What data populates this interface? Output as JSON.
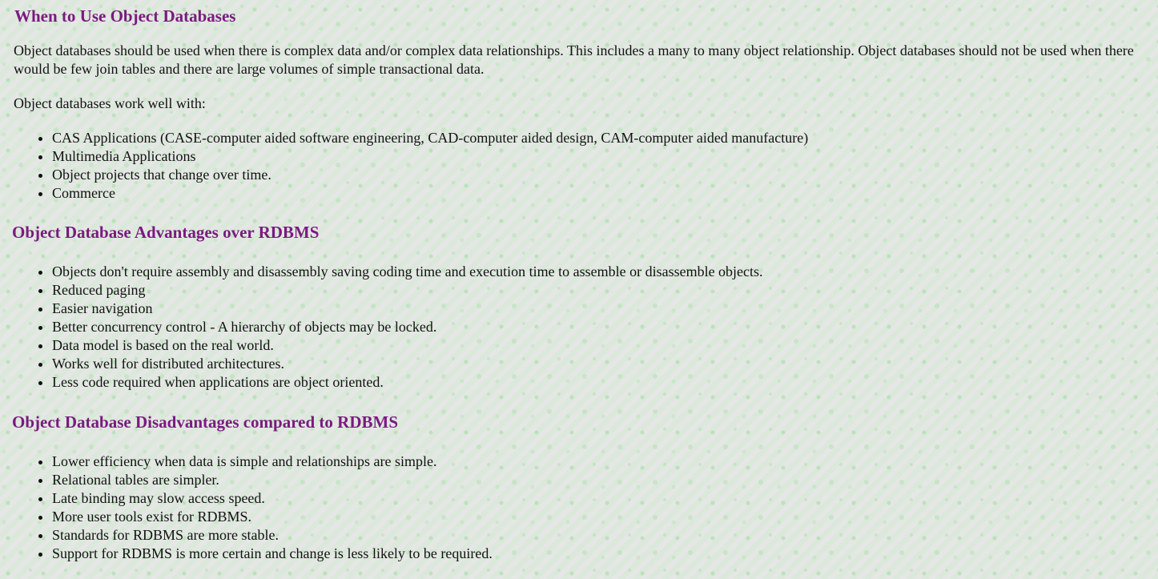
{
  "sections": {
    "when": {
      "heading": "When to Use Object Databases",
      "intro": "Object databases should be used when there is complex data and/or complex data relationships. This includes a many to many object relationship. Object databases should not be used when there would be few join tables and there are large volumes of simple transactional data.",
      "workwell": "Object databases work well with:",
      "items": [
        "CAS Applications (CASE-computer aided software engineering, CAD-computer aided design, CAM-computer aided manufacture)",
        "Multimedia Applications",
        "Object projects that change over time.",
        "Commerce"
      ]
    },
    "advantages": {
      "heading": "Object Database Advantages over RDBMS",
      "items": [
        "Objects don't require assembly and disassembly saving coding time and execution time to assemble or disassemble objects.",
        "Reduced paging",
        "Easier navigation",
        "Better concurrency control - A hierarchy of objects may be locked.",
        "Data model is based on the real world.",
        "Works well for distributed architectures.",
        "Less code required when applications are object oriented."
      ]
    },
    "disadvantages": {
      "heading": "Object Database Disadvantages compared to RDBMS",
      "items": [
        "Lower efficiency when data is simple and relationships are simple.",
        "Relational tables are simpler.",
        "Late binding may slow access speed.",
        "More user tools exist for RDBMS.",
        "Standards for RDBMS are more stable.",
        "Support for RDBMS is more certain and change is less likely to be required."
      ]
    }
  },
  "colors": {
    "heading": "#7a1a7f",
    "text": "#111111",
    "background": "#e4e7e4",
    "texture_accent": "#a0dca0"
  }
}
